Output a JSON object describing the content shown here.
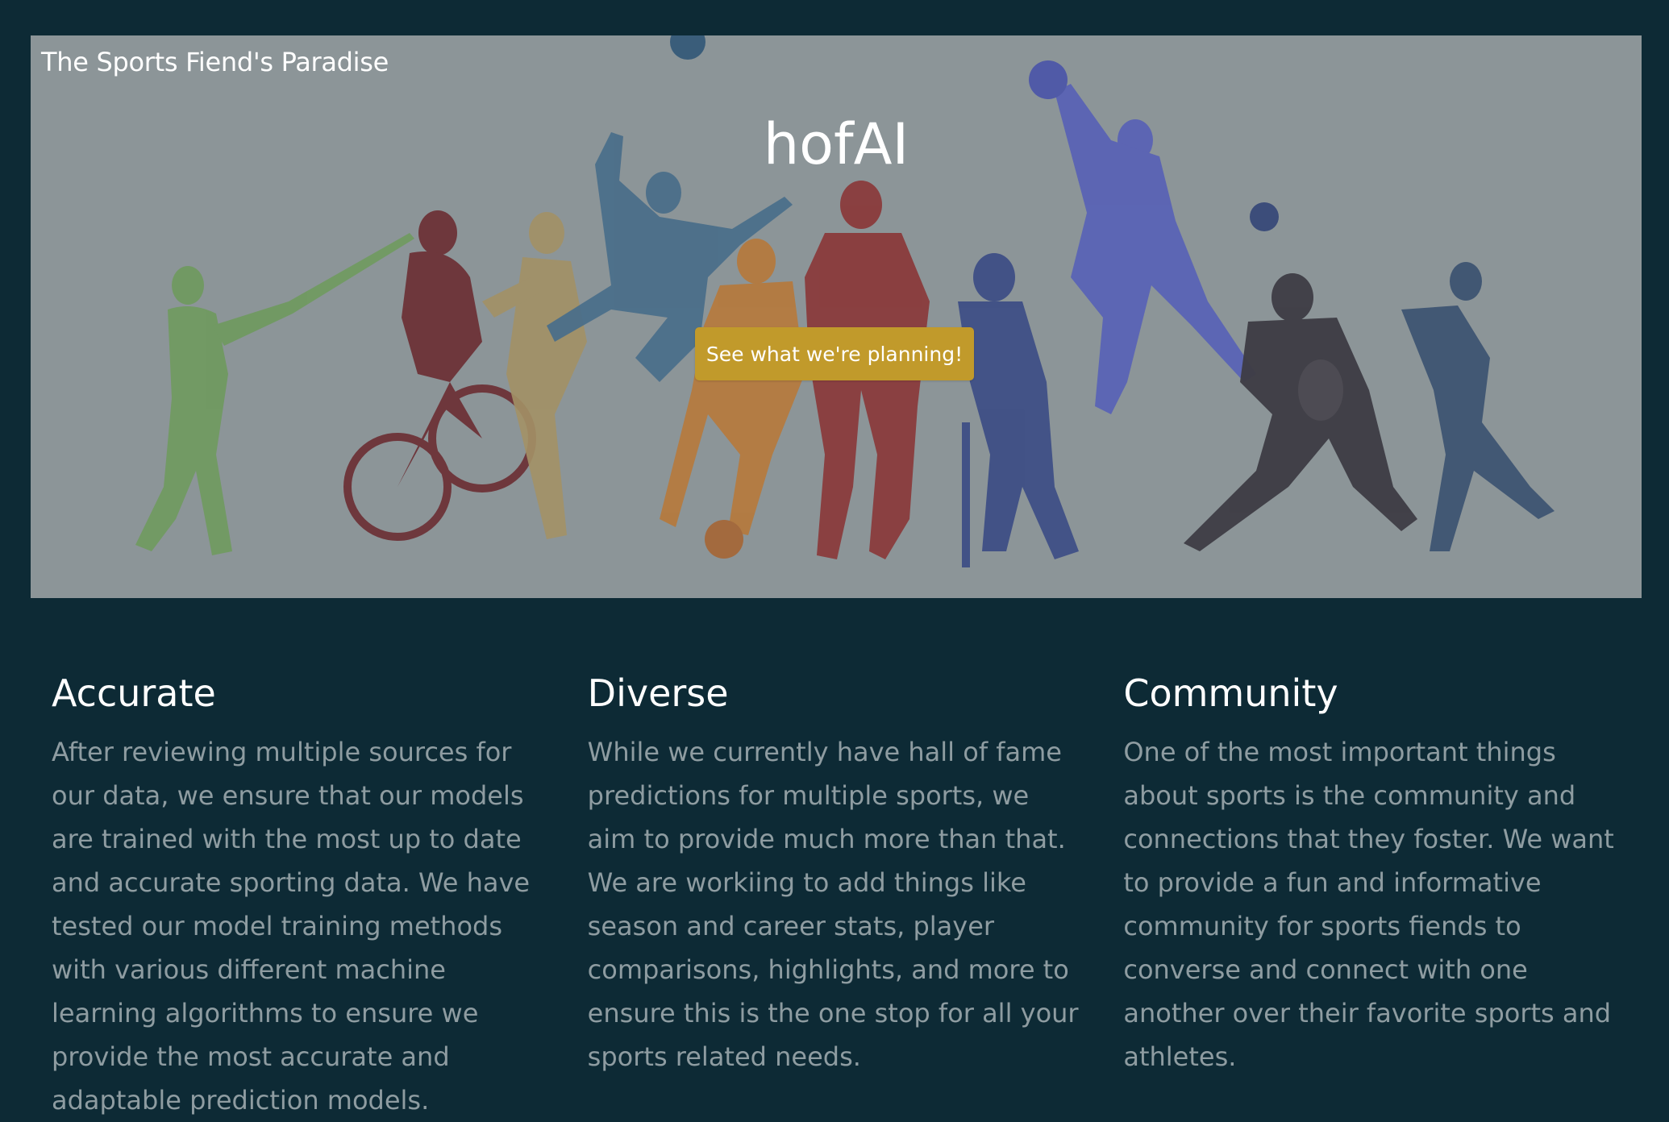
{
  "hero": {
    "brand": "The Sports Fiend's Paradise",
    "title": "hofAI",
    "cta_label": "See what we're planning!"
  },
  "features": [
    {
      "title": "Accurate",
      "body": "After reviewing multiple sources for our data, we ensure that our models are trained with the most up to date and accurate sporting data. We have tested our model training methods with various different machine learning algorithms to ensure we provide the most accurate and adaptable prediction models."
    },
    {
      "title": "Diverse",
      "body": "While we currently have hall of fame predictions for multiple sports, we aim to provide much more than that. We are workiing to add things like season and career stats, player comparisons, highlights, and more to ensure this is the one stop for all your sports related needs."
    },
    {
      "title": "Community",
      "body": "One of the most important things about sports is the community and connections that they foster. We want to provide a fun and informative community for sports fiends to converse and connect with one another over their favorite sports and athletes."
    }
  ],
  "colors": {
    "background": "#0d2a35",
    "hero_overlay": "#8c9598",
    "cta": "#c19a2b",
    "body_text": "#8e9ca1"
  }
}
